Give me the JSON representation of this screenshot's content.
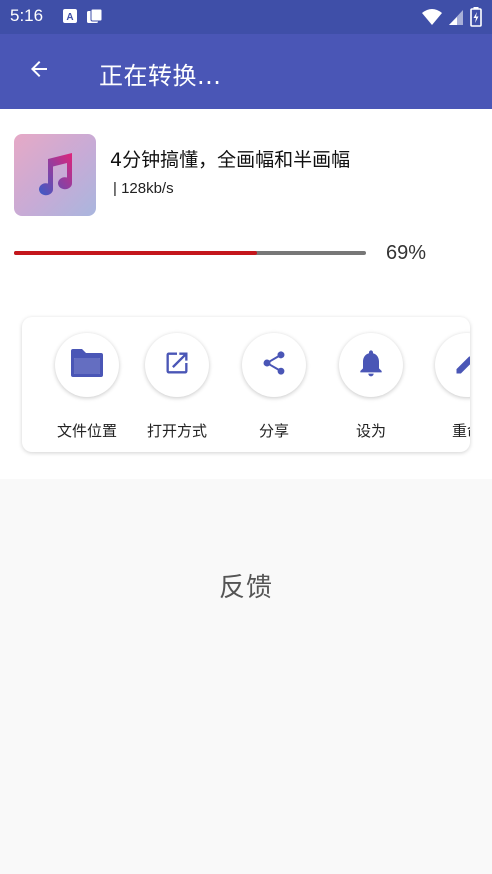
{
  "status_bar": {
    "time": "5:16",
    "left_icons": [
      "font-notification-icon",
      "files-notification-icon"
    ],
    "right_icons": [
      "wifi-icon",
      "signal-icon",
      "battery-charging-icon"
    ]
  },
  "app_bar": {
    "back_icon": "arrow-back-icon",
    "title": "正在转换..."
  },
  "file": {
    "thumbnail_icon": "music-note-icon",
    "title": "4分钟搞懂，全画幅和半画幅",
    "meta": "| 128kb/s"
  },
  "progress": {
    "percent": 69,
    "percent_label": "69%",
    "fill_color": "#c4161c"
  },
  "actions": [
    {
      "icon": "folder-icon",
      "label": "文件位置"
    },
    {
      "icon": "open-external-icon",
      "label": "打开方式"
    },
    {
      "icon": "share-icon",
      "label": "分享"
    },
    {
      "icon": "bell-icon",
      "label": "设为"
    },
    {
      "icon": "edit-icon",
      "label": "重命"
    }
  ],
  "feedback": {
    "label": "反馈"
  },
  "colors": {
    "primary": "#4a56b6",
    "status_bar": "#3f4fa8",
    "accent_icon": "#4a56b6"
  }
}
